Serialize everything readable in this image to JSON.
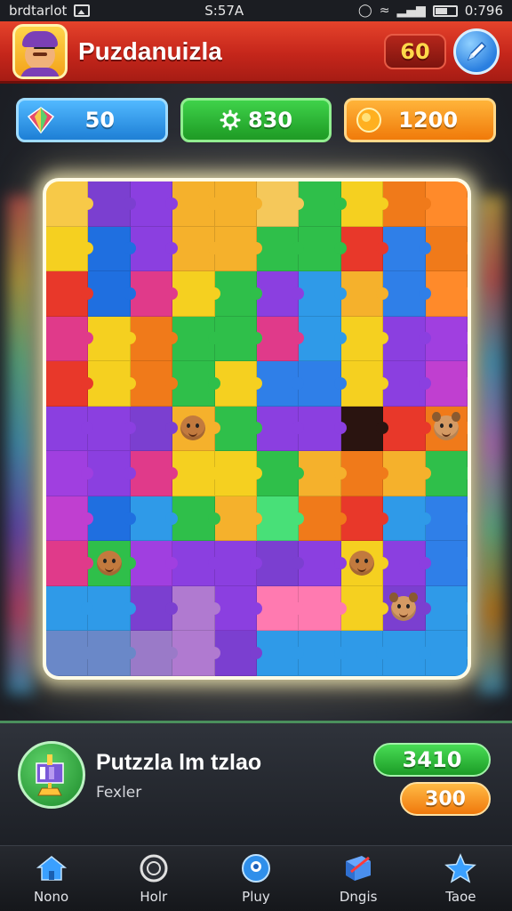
{
  "status_bar": {
    "carrier": "brdtarlot",
    "time": "S:57A",
    "battery": "0:796"
  },
  "header": {
    "title": "Puzdanuizla",
    "level": "60",
    "edit_icon": "pencil-icon"
  },
  "stats": {
    "gems": {
      "value": "50",
      "icon": "gem-icon"
    },
    "score": {
      "value": "830",
      "icon": "gear-icon"
    },
    "coins": {
      "value": "1200",
      "icon": "coin-icon"
    }
  },
  "board": {
    "columns": 10,
    "rows": 11,
    "tile_colors": [
      [
        "#f7c948",
        "#7b3fd0",
        "#8b3fe0",
        "#f5b12c",
        "#f5b12c",
        "#f5c85a",
        "#2fbf4a",
        "#f5d020",
        "#f07a1a",
        "#ff8a2a"
      ],
      [
        "#f5d020",
        "#1f6fe0",
        "#8b3fe0",
        "#f5b12c",
        "#f5b12c",
        "#2fbf4a",
        "#2fbf4a",
        "#e8382a",
        "#2f7fe8",
        "#f07a1a"
      ],
      [
        "#e8382a",
        "#1f6fe0",
        "#e03a8a",
        "#f5d020",
        "#2fbf4a",
        "#8b3fe0",
        "#2f9ae8",
        "#f5b12c",
        "#2f7fe8",
        "#ff8a2a"
      ],
      [
        "#e03a8a",
        "#f5d020",
        "#f07a1a",
        "#2fbf4a",
        "#2fbf4a",
        "#e03a8a",
        "#2f9ae8",
        "#f5d020",
        "#8b3fe0",
        "#a03fe0"
      ],
      [
        "#e8382a",
        "#f5d020",
        "#f07a1a",
        "#2fbf4a",
        "#f5d020",
        "#2f7fe8",
        "#2f7fe8",
        "#f5d020",
        "#8b3fe0",
        "#c03fd0"
      ],
      [
        "#8b3fe0",
        "#8b3fe0",
        "#7b3fd0",
        "#f5b12c",
        "#2fbf4a",
        "#8b3fe0",
        "#8b3fe0",
        "#2a1410",
        "#e8382a",
        "#f07a1a"
      ],
      [
        "#a03fe0",
        "#8b3fe0",
        "#e03a8a",
        "#f5d020",
        "#f5d020",
        "#2fbf4a",
        "#f5b12c",
        "#f07a1a",
        "#f5b12c",
        "#2fbf4a"
      ],
      [
        "#c03fd0",
        "#1f6fe0",
        "#2f9ae8",
        "#2fbf4a",
        "#f5b12c",
        "#48e078",
        "#f07a1a",
        "#e8382a",
        "#2f9ae8",
        "#2f7fe8"
      ],
      [
        "#e03a8a",
        "#2fbf4a",
        "#a03fe0",
        "#8b3fe0",
        "#8b3fe0",
        "#7b3fd0",
        "#8b3fe0",
        "#f5d020",
        "#8b3fe0",
        "#2f7fe8"
      ],
      [
        "#2f9ae8",
        "#2f9ae8",
        "#7b3fd0",
        "#b07ad0",
        "#8b3fe0",
        "#ff7ab0",
        "#ff7ab0",
        "#f5d020",
        "#7b3fd0",
        "#2f9ae8"
      ],
      [
        "#6a88c8",
        "#6a88c8",
        "#9a7ac8",
        "#b07ad0",
        "#7b3fd0",
        "#2f9ae8",
        "#2f9ae8",
        "#2f9ae8",
        "#2f9ae8",
        "#2f9ae8"
      ]
    ],
    "characters": [
      {
        "row": 5,
        "col": 3,
        "kind": "kid"
      },
      {
        "row": 5,
        "col": 9,
        "kind": "dog"
      },
      {
        "row": 8,
        "col": 1,
        "kind": "kid"
      },
      {
        "row": 8,
        "col": 7,
        "kind": "kid"
      },
      {
        "row": 9,
        "col": 8,
        "kind": "dog"
      }
    ]
  },
  "panel": {
    "icon": "trophy-icon",
    "title": "Putzzla lm tzlao",
    "subtitle": "Fexler",
    "reward_green": "3410",
    "reward_orange": "300"
  },
  "nav": {
    "items": [
      {
        "label": "Nono",
        "icon": "home-icon",
        "color": "#3aa0ff"
      },
      {
        "label": "Holr",
        "icon": "clock-icon",
        "color": "#e0e0e0"
      },
      {
        "label": "Pluy",
        "icon": "play-icon",
        "color": "#3aa0ff"
      },
      {
        "label": "Dngis",
        "icon": "cube-icon",
        "color": "#3aa0ff"
      },
      {
        "label": "Taoe",
        "icon": "star-icon",
        "color": "#3aa0ff"
      }
    ]
  }
}
